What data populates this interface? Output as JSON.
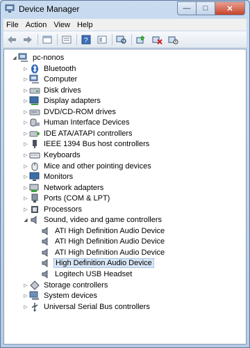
{
  "window": {
    "title": "Device Manager"
  },
  "title_buttons": {
    "minimize": "—",
    "maximize": "□",
    "close": "✕"
  },
  "menu": {
    "file": "File",
    "action": "Action",
    "view": "View",
    "help": "Help"
  },
  "toolbar": {
    "icons": [
      "back-arrow-icon",
      "forward-arrow-icon",
      "properties-icon",
      "show-hide-tree-icon",
      "help-icon",
      "details-icon",
      "scan-hardware-icon",
      "update-driver-icon",
      "uninstall-icon",
      "disable-icon"
    ]
  },
  "tree": {
    "root": "pc-nonos",
    "categories": [
      "Bluetooth",
      "Computer",
      "Disk drives",
      "Display adapters",
      "DVD/CD-ROM drives",
      "Human Interface Devices",
      "IDE ATA/ATAPI controllers",
      "IEEE 1394 Bus host controllers",
      "Keyboards",
      "Mice and other pointing devices",
      "Monitors",
      "Network adapters",
      "Ports (COM & LPT)",
      "Processors",
      "Sound, video and game controllers",
      "Storage controllers",
      "System devices",
      "Universal Serial Bus controllers"
    ],
    "sound_devices": [
      "ATI High Definition Audio Device",
      "ATI High Definition Audio Device",
      "ATI High Definition Audio Device",
      "High Definition Audio Device",
      "Logitech USB Headset"
    ],
    "selected_device": "High Definition Audio Device"
  }
}
